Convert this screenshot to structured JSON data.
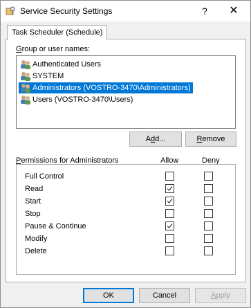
{
  "window": {
    "title": "Service Security Settings",
    "help_glyph": "?",
    "close_glyph": "✕"
  },
  "tab": {
    "label": "Task Scheduler (Schedule)"
  },
  "groups": {
    "label_first": "G",
    "label_rest": "roup or user names:",
    "items": [
      {
        "label": "Authenticated Users",
        "selected": false
      },
      {
        "label": "SYSTEM",
        "selected": false
      },
      {
        "label": "Administrators (VOSTRO-3470\\Administrators)",
        "selected": true
      },
      {
        "label": "Users (VOSTRO-3470\\Users)",
        "selected": false
      }
    ]
  },
  "buttons": {
    "add_prefix": "A",
    "add_under": "d",
    "add_suffix": "d...",
    "remove_under": "R",
    "remove_suffix": "emove"
  },
  "permissions": {
    "header_under": "P",
    "header_rest": "ermissions for Administrators",
    "allow_label": "Allow",
    "deny_label": "Deny",
    "rows": [
      {
        "name": "Full Control",
        "allow": false,
        "deny": false
      },
      {
        "name": "Read",
        "allow": true,
        "deny": false
      },
      {
        "name": "Start",
        "allow": true,
        "deny": false
      },
      {
        "name": "Stop",
        "allow": false,
        "deny": false
      },
      {
        "name": "Pause & Continue",
        "allow": true,
        "deny": false
      },
      {
        "name": "Modify",
        "allow": false,
        "deny": false
      },
      {
        "name": "Delete",
        "allow": false,
        "deny": false
      }
    ]
  },
  "footer": {
    "ok_label": "OK",
    "cancel_label": "Cancel",
    "apply_under": "A",
    "apply_suffix": "pply"
  },
  "icons": {
    "window": "shield-key-icon",
    "user": "user-group-icon"
  }
}
